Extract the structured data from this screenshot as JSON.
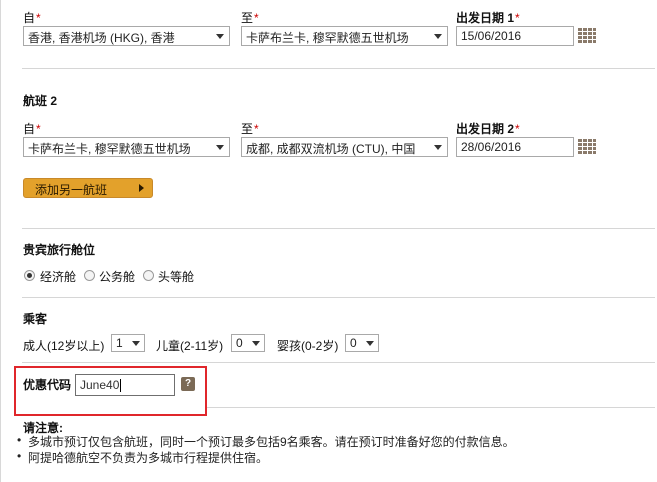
{
  "flight1": {
    "from_label": "自",
    "to_label": "至",
    "date_label": "出发日期 1",
    "from_value": "香港, 香港机场 (HKG), 香港",
    "to_value": "卡萨布兰卡, 穆罕默德五世机场",
    "date_value": "15/06/2016"
  },
  "flight2": {
    "title": "航班 2",
    "from_label": "自",
    "to_label": "至",
    "date_label": "出发日期 2",
    "from_value": "卡萨布兰卡, 穆罕默德五世机场",
    "to_value": "成都, 成都双流机场 (CTU), 中国",
    "date_value": "28/06/2016"
  },
  "required_mark": "*",
  "add_flight_label": "添加另一航班",
  "cabin": {
    "title": "贵宾旅行舱位",
    "options": [
      "经济舱",
      "公务舱",
      "头等舱"
    ],
    "selected": "经济舱"
  },
  "passengers": {
    "title": "乘客",
    "adult_label": "成人(12岁以上)",
    "adult_value": "1",
    "child_label": "儿童(2-11岁)",
    "child_value": "0",
    "infant_label": "婴孩(0-2岁)",
    "infant_value": "0"
  },
  "promo": {
    "label": "优惠代码",
    "value": "June40",
    "help_icon_text": "?"
  },
  "notes": {
    "title": "请注意:",
    "items": [
      "多城市预订仅包含航班，同时一个预订最多包括9名乘客。请在预订时准备好您的付款信息。",
      "阿提哈德航空不负责为多城市行程提供住宿。"
    ]
  },
  "colors": {
    "button": "#e3a12b",
    "highlight_box": "#e0262b",
    "required": "#cc0000"
  }
}
